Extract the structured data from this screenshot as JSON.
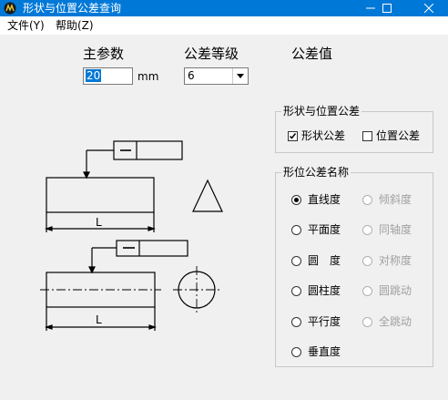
{
  "window": {
    "title": "形状与位置公差查询",
    "controls": [
      "minimize",
      "maximize",
      "close"
    ]
  },
  "menu": [
    {
      "label": "文件(Y)"
    },
    {
      "label": "帮助(Z)"
    }
  ],
  "form": {
    "main_param_label": "主参数",
    "main_param_value": "20",
    "unit": "mm",
    "grade_label": "公差等级",
    "grade_value": "6",
    "tolerance_label": "公差值",
    "tolerance_value": ""
  },
  "shape_position_group": {
    "legend": "形状与位置公差",
    "options": [
      {
        "label": "形状公差",
        "checked": true
      },
      {
        "label": "位置公差",
        "checked": false
      }
    ]
  },
  "tolerance_name_group": {
    "legend": "形位公差名称",
    "left": [
      {
        "label": "直线度",
        "selected": true,
        "enabled": true
      },
      {
        "label": "平面度",
        "selected": false,
        "enabled": true
      },
      {
        "label": "圆　度",
        "selected": false,
        "enabled": true
      },
      {
        "label": "圆柱度",
        "selected": false,
        "enabled": true
      },
      {
        "label": "平行度",
        "selected": false,
        "enabled": true
      },
      {
        "label": "垂直度",
        "selected": false,
        "enabled": true
      }
    ],
    "right": [
      {
        "label": "倾斜度",
        "selected": false,
        "enabled": false
      },
      {
        "label": "同轴度",
        "selected": false,
        "enabled": false
      },
      {
        "label": "对称度",
        "selected": false,
        "enabled": false
      },
      {
        "label": "圆跳动",
        "selected": false,
        "enabled": false
      },
      {
        "label": "全跳动",
        "selected": false,
        "enabled": false
      }
    ]
  },
  "drawing": {
    "dimension_label_1": "L",
    "dimension_label_2": "L"
  },
  "colors": {
    "titlebar": "#0078d7",
    "background": "#f0f0f0",
    "disabled_text": "#a0a0a0"
  }
}
